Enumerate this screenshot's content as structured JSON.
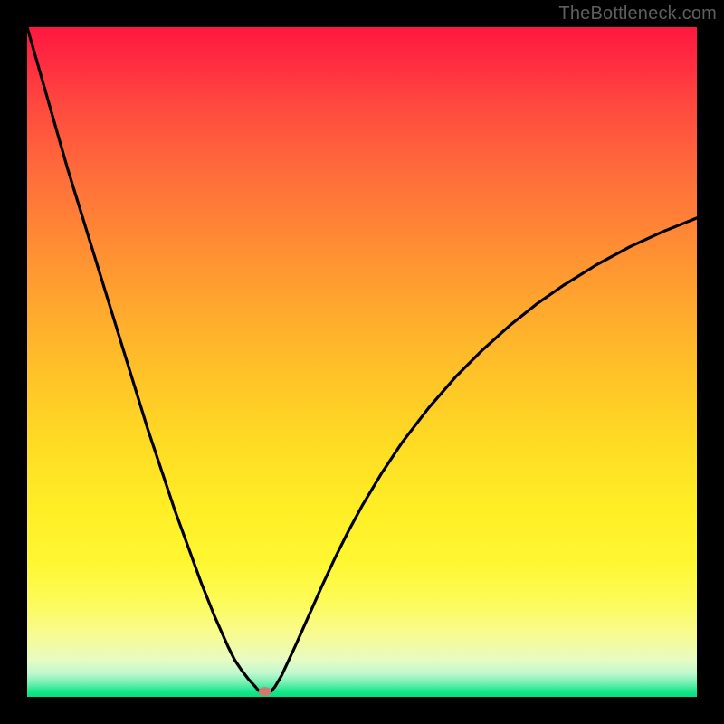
{
  "watermark": "TheBottleneck.com",
  "chart_data": {
    "type": "line",
    "title": "",
    "xlabel": "",
    "ylabel": "",
    "xlim": [
      0,
      100
    ],
    "ylim": [
      0,
      100
    ],
    "grid": false,
    "legend": false,
    "background_gradient_top_color": "#ff183f",
    "background_gradient_bottom_color": "#00e183",
    "curve_min_x": 35,
    "marker": {
      "x": 35.5,
      "y": 0.8,
      "color": "#cf7a6f",
      "rx": 7,
      "ry": 5
    },
    "series": [
      {
        "name": "bottleneck-curve",
        "color": "#000000",
        "x": [
          0,
          2,
          4,
          6,
          8,
          10,
          12,
          14,
          16,
          18,
          20,
          22,
          24,
          26,
          28,
          30,
          31,
          32,
          33,
          34,
          34.5,
          35,
          35.5,
          36,
          36.5,
          37,
          38,
          40,
          42,
          44,
          46,
          48,
          50,
          53,
          56,
          60,
          64,
          68,
          72,
          76,
          80,
          85,
          90,
          95,
          100
        ],
        "y": [
          100,
          93,
          86,
          79,
          72.5,
          66,
          59.5,
          53,
          46.5,
          40,
          34,
          28,
          22.5,
          17,
          12,
          7.5,
          5.5,
          4,
          2.7,
          1.6,
          1.0,
          0.6,
          0.5,
          0.6,
          0.9,
          1.5,
          3.2,
          7.5,
          12,
          16.5,
          20.8,
          24.8,
          28.5,
          33.5,
          38,
          43.2,
          47.8,
          51.8,
          55.4,
          58.6,
          61.4,
          64.5,
          67.2,
          69.5,
          71.5
        ]
      }
    ]
  }
}
